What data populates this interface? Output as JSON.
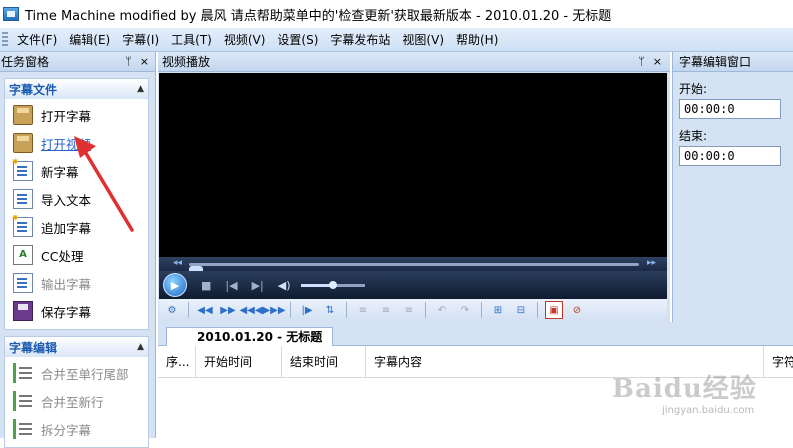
{
  "window": {
    "title": "Time Machine modified by 晨风 请点帮助菜单中的'检查更新'获取最新版本 - 2010.01.20 - 无标题"
  },
  "menu": {
    "items": [
      "文件(F)",
      "编辑(E)",
      "字幕(I)",
      "工具(T)",
      "视频(V)",
      "设置(S)",
      "字幕发布站",
      "视图(V)",
      "帮助(H)"
    ]
  },
  "taskpane": {
    "title": "任务窗格",
    "pin_glyph": "ᛘ",
    "close_glyph": "×",
    "groups": [
      {
        "title": "字幕文件",
        "items": [
          {
            "label": "打开字幕",
            "icon": "open-subtitle-icon",
            "state": "normal"
          },
          {
            "label": "打开视频",
            "icon": "open-video-icon",
            "state": "link"
          },
          {
            "label": "新字幕",
            "icon": "new-subtitle-icon",
            "state": "normal"
          },
          {
            "label": "导入文本",
            "icon": "import-text-icon",
            "state": "normal"
          },
          {
            "label": "追加字幕",
            "icon": "append-subtitle-icon",
            "state": "normal"
          },
          {
            "label": "CC处理",
            "icon": "cc-icon",
            "state": "normal"
          },
          {
            "label": "输出字幕",
            "icon": "export-subtitle-icon",
            "state": "disabled"
          },
          {
            "label": "保存字幕",
            "icon": "save-icon",
            "state": "normal"
          }
        ]
      },
      {
        "title": "字幕编辑",
        "items": [
          {
            "label": "合并至单行尾部",
            "icon": "merge-tail-icon",
            "state": "disabled"
          },
          {
            "label": "合并至新行",
            "icon": "merge-new-line-icon",
            "state": "disabled"
          },
          {
            "label": "拆分字幕",
            "icon": "split-subtitle-icon",
            "state": "disabled"
          }
        ]
      }
    ]
  },
  "video": {
    "title": "视频播放",
    "volume_level": 0.5,
    "seek_position": 0.0
  },
  "editor": {
    "title": "字幕编辑窗口",
    "start_label": "开始:",
    "start_value": "00:00:0",
    "end_label": "结束:",
    "end_value": "00:00:0"
  },
  "document": {
    "tab_label": "2010.01.20 - 无标题",
    "columns": [
      "序...",
      "开始时间",
      "结束时间",
      "字幕内容",
      "字符"
    ]
  },
  "watermark": {
    "main": "Baidu经验",
    "sub": "jingyan.baidu.com"
  },
  "colors": {
    "accent": "#1b5bb2",
    "annotation_arrow": "#e03030",
    "video_bg": "#000000"
  }
}
